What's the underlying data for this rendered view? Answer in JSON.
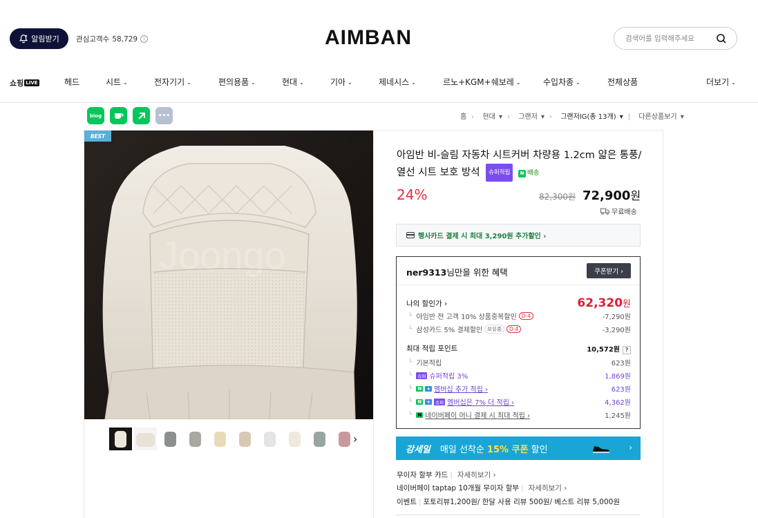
{
  "header": {
    "notify_label": "알림받기",
    "interest_label": "관심고객수",
    "interest_count": "58,729",
    "logo": "AIMBAN",
    "search_placeholder": "검색어를 입력해주세요"
  },
  "nav": {
    "shopping_live": "쇼핑",
    "live_tag": "LIVE",
    "items": [
      "헤드",
      "시트",
      "전자기기",
      "편의용품",
      "현대",
      "기아",
      "제네시스",
      "르노+KGM+쉐보레",
      "수입차종",
      "전체상품",
      "더보기"
    ]
  },
  "share": {
    "blog": "blog",
    "more": "•••"
  },
  "breadcrumb": {
    "home": "홈",
    "level1": "현대",
    "level2": "그랜저",
    "current": "그랜저IG(총 13개)",
    "other": "다른상품보기"
  },
  "gallery": {
    "best_tag": "BEST",
    "watermark": "Joongo"
  },
  "product": {
    "title": "아임반 비-슬림 자동차 시트커버 차량용 1.2cm 얇은 통풍/열선 시트 보호 방석",
    "super_badge": "슈퍼적립",
    "n_delivery": "배송",
    "discount": "24%",
    "original_price": "82,300원",
    "price": "72,900",
    "price_unit": "원",
    "shipping": "무료배송"
  },
  "card_promo": "행사카드 결제 시 최대 3,290원 추가할인 ›",
  "benefit": {
    "user": "ner9313",
    "headline": "님만을 위한 혜택",
    "coupon_button": "쿠폰받기 ›",
    "my_price_label": "나의 할인가 ›",
    "my_price": "62,320",
    "my_price_unit": "원",
    "discounts": [
      {
        "label": "아임반 전 고객 10% 상품중복할인",
        "badge": "D-4",
        "value": "-7,290원"
      },
      {
        "label": "삼성카드 5% 결제할인",
        "badge2": "보유중",
        "badge": "D-4",
        "value": "-3,290원"
      }
    ],
    "points_label": "최대 적립 포인트",
    "points_total": "10,572원",
    "points_help": "?",
    "points": [
      {
        "label": "기본적립",
        "value": "623원"
      },
      {
        "badge": "슈퍼",
        "label": "슈퍼적립 3%",
        "value": "1,869원"
      },
      {
        "badge": "N",
        "badge_plus": "+",
        "label": "멤버십 추가 적립 ›",
        "value": "623원"
      },
      {
        "badge": "N",
        "badge_plus": "+",
        "badge3": "슈퍼",
        "label": "멤버십은 7% 더 적립 ›",
        "value": "4,362원"
      },
      {
        "badge": "N",
        "label": "네이버페이 머니 결제 시 최대 적립 ›",
        "value": "1,245원"
      }
    ]
  },
  "banner": {
    "logo": "강세일",
    "text_prefix": "매일 선착순",
    "text_highlight": "15% 쿠폰",
    "text_suffix": "할인",
    "arrow": "›"
  },
  "extra": {
    "card_label": "무이자 할부 카드",
    "card_more": "자세히보기 ›",
    "taptap_label": "네이버페이 taptap 10개월 무이자 할부",
    "taptap_more": "자세히보기 ›",
    "event_label": "이벤트",
    "event_text": "포토리뷰1,200원/ 한달 사용 리뷰 500원/ 베스트 리뷰 5,000원"
  },
  "colors": {
    "navy": "#0f1236",
    "discount_red": "#e03040",
    "price_red": "#d81f35",
    "banner_blue": "#19a6d6",
    "super_purple": "#7b4df0",
    "naver_green": "#03c75a"
  }
}
